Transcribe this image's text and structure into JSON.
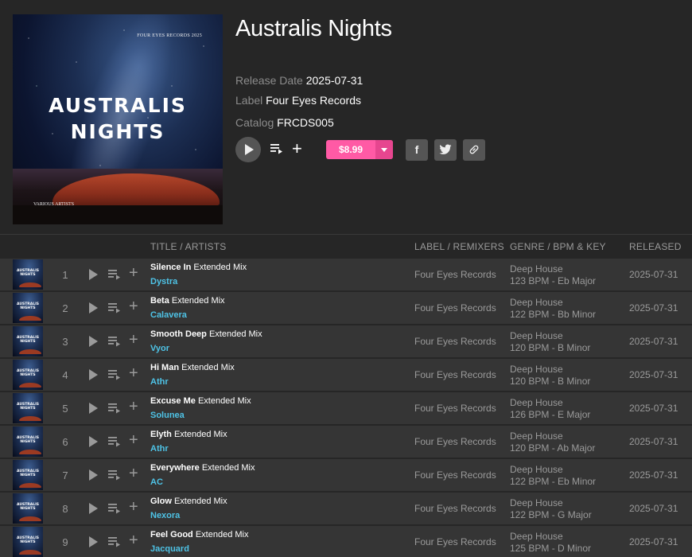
{
  "release": {
    "cover": {
      "publisher_text": "FOUR EYES RECORDS 2025",
      "title_line1": "AUSTRALIS",
      "title_line2": "NIGHTS",
      "artist_text": "VARIOUS ARTISTS"
    },
    "title": "Australis Nights",
    "release_date_label": "Release Date",
    "release_date": "2025-07-31",
    "label_label": "Label",
    "label": "Four Eyes Records",
    "catalog_label": "Catalog",
    "catalog": "FRCDS005",
    "price": "$8.99",
    "accent_color": "#ff5aa5",
    "artist_link_color": "#4ec3e6"
  },
  "table": {
    "headers": {
      "title": "TITLE / ARTISTS",
      "label": "LABEL / REMIXERS",
      "genre": "GENRE / BPM & KEY",
      "released": "RELEASED"
    },
    "tracks": [
      {
        "num": "1",
        "name": "Silence In",
        "mix": "Extended Mix",
        "artist": "Dystra",
        "label": "Four Eyes Records",
        "genre": "Deep House",
        "bpm_key": "123 BPM - Eb Major",
        "released": "2025-07-31"
      },
      {
        "num": "2",
        "name": "Beta",
        "mix": "Extended Mix",
        "artist": "Calavera",
        "label": "Four Eyes Records",
        "genre": "Deep House",
        "bpm_key": "122 BPM - Bb Minor",
        "released": "2025-07-31"
      },
      {
        "num": "3",
        "name": "Smooth Deep",
        "mix": "Extended Mix",
        "artist": "Vyor",
        "label": "Four Eyes Records",
        "genre": "Deep House",
        "bpm_key": "120 BPM - B Minor",
        "released": "2025-07-31"
      },
      {
        "num": "4",
        "name": "Hi Man",
        "mix": "Extended Mix",
        "artist": "Athr",
        "label": "Four Eyes Records",
        "genre": "Deep House",
        "bpm_key": "120 BPM - B Minor",
        "released": "2025-07-31"
      },
      {
        "num": "5",
        "name": "Excuse Me",
        "mix": "Extended Mix",
        "artist": "Solunea",
        "label": "Four Eyes Records",
        "genre": "Deep House",
        "bpm_key": "126 BPM - E Major",
        "released": "2025-07-31"
      },
      {
        "num": "6",
        "name": "Elyth",
        "mix": "Extended Mix",
        "artist": "Athr",
        "label": "Four Eyes Records",
        "genre": "Deep House",
        "bpm_key": "120 BPM - Ab Major",
        "released": "2025-07-31"
      },
      {
        "num": "7",
        "name": "Everywhere",
        "mix": "Extended Mix",
        "artist": "AC",
        "label": "Four Eyes Records",
        "genre": "Deep House",
        "bpm_key": "122 BPM - Eb Minor",
        "released": "2025-07-31"
      },
      {
        "num": "8",
        "name": "Glow",
        "mix": "Extended Mix",
        "artist": "Nexora",
        "label": "Four Eyes Records",
        "genre": "Deep House",
        "bpm_key": "122 BPM - G Major",
        "released": "2025-07-31"
      },
      {
        "num": "9",
        "name": "Feel Good",
        "mix": "Extended Mix",
        "artist": "Jacquard",
        "label": "Four Eyes Records",
        "genre": "Deep House",
        "bpm_key": "125 BPM - D Minor",
        "released": "2025-07-31"
      }
    ]
  }
}
